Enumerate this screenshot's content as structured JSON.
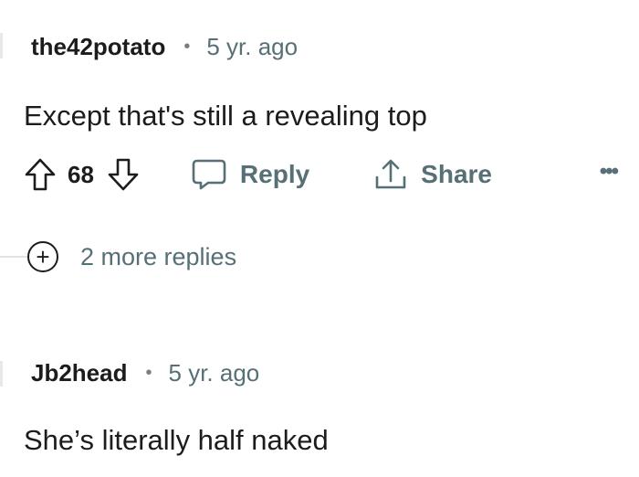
{
  "comments": [
    {
      "username": "the42potato",
      "separator": "•",
      "timestamp": "5 yr. ago",
      "body": "Except that's still a revealing top",
      "votes": "68",
      "actions": {
        "reply_label": "Reply",
        "share_label": "Share",
        "more_label": "•••"
      },
      "more_replies": {
        "icon": "+",
        "label": "2 more replies"
      }
    },
    {
      "username": "Jb2head",
      "separator": "•",
      "timestamp": "5 yr. ago",
      "body": "She’s literally half naked"
    }
  ],
  "icons": {
    "upvote": "arrow-up-icon",
    "downvote": "arrow-down-icon",
    "reply": "speech-bubble-icon",
    "share": "share-icon",
    "more": "ellipsis-icon",
    "expand": "plus-circle-icon"
  }
}
